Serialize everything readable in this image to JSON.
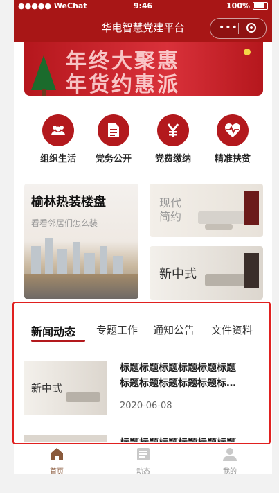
{
  "status": {
    "carrier": "●●●●● WeChat",
    "time": "9:46",
    "battery": "100%"
  },
  "nav": {
    "title": "华电智慧党建平台",
    "more": "•••"
  },
  "banner": {
    "line1": "年终大聚惠",
    "line2": "年货约惠派"
  },
  "quick": [
    {
      "label": "组织生活",
      "icon": "group-icon"
    },
    {
      "label": "党务公开",
      "icon": "document-icon"
    },
    {
      "label": "党费缴纳",
      "icon": "yen-icon"
    },
    {
      "label": "精准扶贫",
      "icon": "heart-pulse-icon"
    }
  ],
  "promo": {
    "left_title": "榆林热装楼盘",
    "left_sub": "看看邻居们怎么装",
    "right_top": "现代\n简约",
    "right_bottom": "新中式"
  },
  "tabs": [
    "新闻动态",
    "专题工作",
    "通知公告",
    "文件资料"
  ],
  "news": [
    {
      "thumb": "新中式",
      "title_line1": "标题标题标题标题标题标题",
      "title_line2": "标题标题标题标题标题标…",
      "date": "2020-06-08"
    }
  ],
  "peek_title": "标题标题标题标题标题标题",
  "tabbar": [
    {
      "label": "首页",
      "icon": "home-icon"
    },
    {
      "label": "动态",
      "icon": "news-icon"
    },
    {
      "label": "我的",
      "icon": "user-icon"
    }
  ],
  "colors": {
    "primary": "#a81616",
    "accent": "#b3191d",
    "highlight": "#e0201f"
  }
}
